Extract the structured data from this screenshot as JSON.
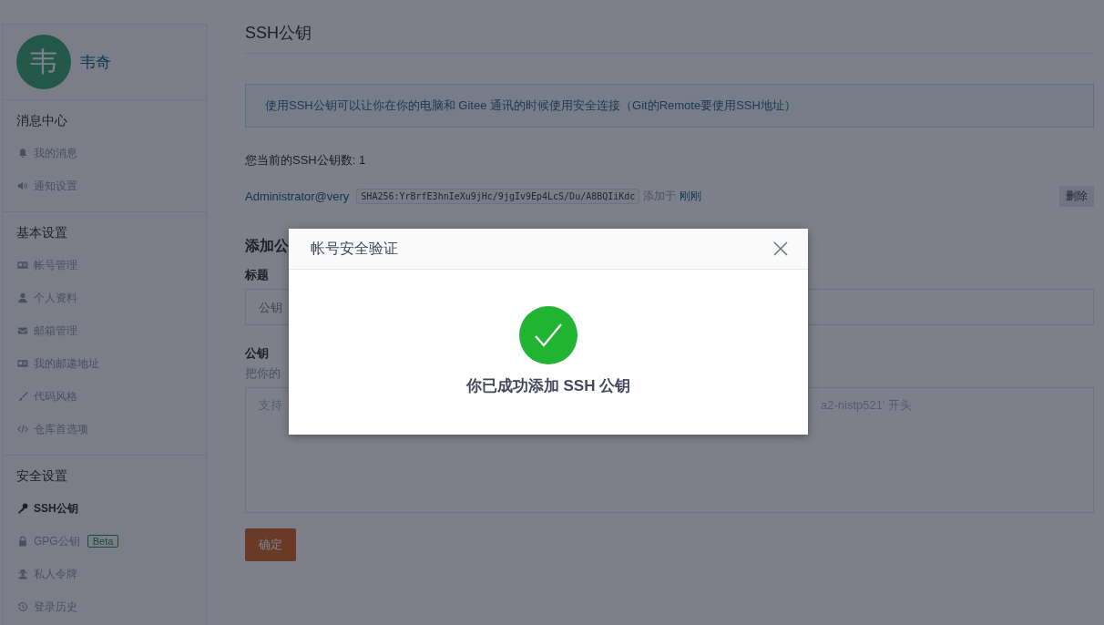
{
  "sidebar": {
    "avatar_letter": "韦",
    "user_name": "韦奇",
    "groups": [
      {
        "title": "消息中心",
        "items": [
          {
            "label": "我的消息",
            "selected": false
          },
          {
            "label": "通知设置",
            "selected": false
          }
        ]
      },
      {
        "title": "基本设置",
        "items": [
          {
            "label": "帐号管理",
            "selected": false
          },
          {
            "label": "个人资料",
            "selected": false
          },
          {
            "label": "邮箱管理",
            "selected": false
          },
          {
            "label": "我的邮递地址",
            "selected": false
          },
          {
            "label": "代码风格",
            "selected": false
          },
          {
            "label": "仓库首选项",
            "selected": false
          }
        ]
      },
      {
        "title": "安全设置",
        "items": [
          {
            "label": "SSH公钥",
            "selected": true
          },
          {
            "label": "GPG公钥",
            "selected": false,
            "badge": "Beta"
          },
          {
            "label": "私人令牌",
            "selected": false
          },
          {
            "label": "登录历史",
            "selected": false
          }
        ]
      }
    ]
  },
  "main": {
    "title": "SSH公钥",
    "info": "使用SSH公钥可以让你在你的电脑和 Gitee 通讯的时候使用安全连接（Git的Remote要使用SSH地址）",
    "count_text": "您当前的SSH公钥数: 1",
    "keys": [
      {
        "name": "Administrator@very",
        "fingerprint": "SHA256:YrBrfE3hnIeXu9jHc/9jgIv9Ep4LcS/Du/A8BQIiKdc",
        "added_label": "添加于",
        "added_time": "刚刚",
        "delete": "删除"
      }
    ],
    "add_heading": "添加公",
    "title_label": "标题",
    "title_placeholder": "公钥",
    "key_label": "公钥",
    "key_hint": "把你的",
    "key_placeholder_start": "支持",
    "key_placeholder_end": "a2-nistp521' 开头",
    "submit": "确定"
  },
  "dialog": {
    "title": "帐号安全验证",
    "message": "你已成功添加 SSH 公钥"
  }
}
